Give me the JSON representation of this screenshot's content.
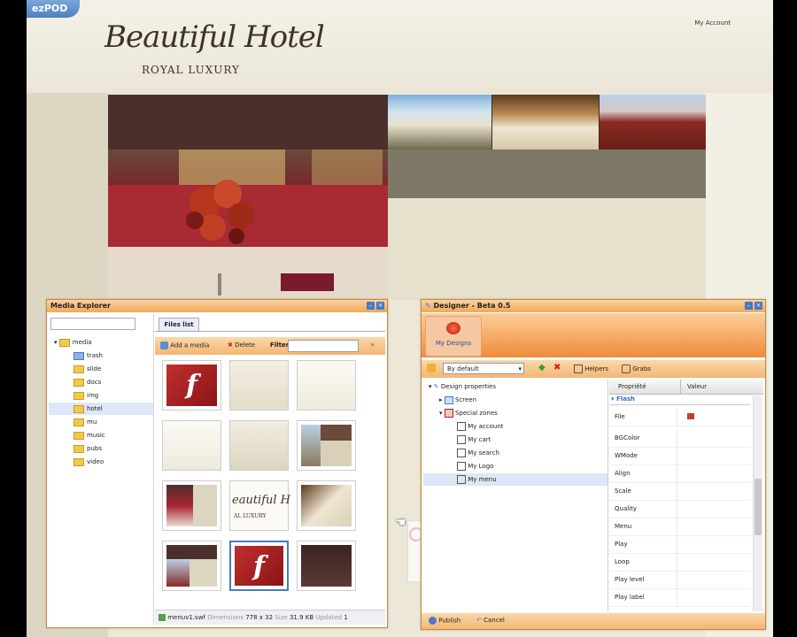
{
  "site": {
    "brand": "ezPOD",
    "my_account": "My Account",
    "logo_script": "Beautiful Hotel",
    "logo_subtitle": "ROYAL LUXURY"
  },
  "media_explorer": {
    "title": "Media Explorer",
    "tree_root": "media",
    "tree_items": [
      "trash",
      "slide",
      "docs",
      "img",
      "hotel",
      "mu",
      "music",
      "pubs",
      "video"
    ],
    "selected_item": "hotel",
    "tab": "Files list",
    "add_media": "Add a media",
    "delete": "Delete",
    "filter": "Filter",
    "thumb_text_1": "eautiful H",
    "thumb_text_2": "AL LUXURY",
    "status": {
      "filename": "menuv1.swf",
      "dimensions_label": "Dimensions",
      "dimensions_value": "778 x 32",
      "size_label": "Size",
      "size_value": "31.9 KB",
      "updated_label": "Updated",
      "updated_value": "1"
    }
  },
  "designer": {
    "title": "Designer - Beta 0.5",
    "my_designs": "My Designs",
    "dropdown_value": "By default",
    "helpers": "Helpers",
    "grabs": "Grabs",
    "tree": {
      "root": "Design properties",
      "screen": "Screen",
      "special_zones": "Special zones",
      "zones": [
        "My account",
        "My cart",
        "My search",
        "My Logo",
        "My menu"
      ],
      "selected": "My menu"
    },
    "prop_header_name": "Propriété",
    "prop_header_value": "Valeur",
    "prop_section": "Flash",
    "properties": [
      "File",
      "BGColor",
      "WMode",
      "Align",
      "Scale",
      "Quality",
      "Menu",
      "Play",
      "Loop",
      "Play level",
      "Play label"
    ],
    "publish": "Publish",
    "cancel": "Cancel"
  },
  "colors": {
    "panel_header": "#f0a858",
    "flash_red": "#b0252a",
    "selection": "#dde7f7"
  }
}
